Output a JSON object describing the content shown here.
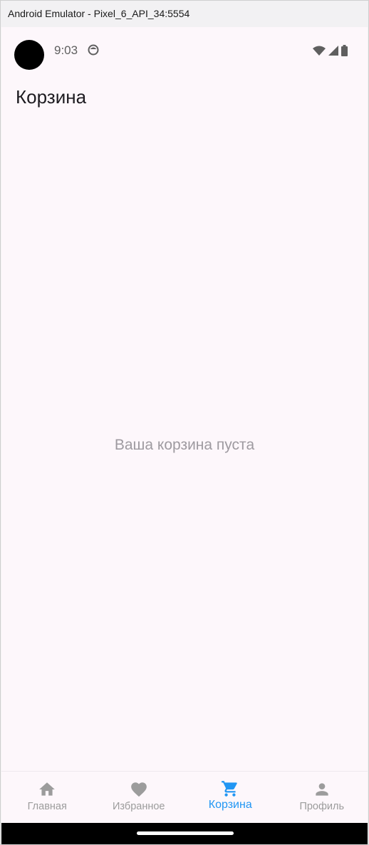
{
  "window": {
    "title": "Android Emulator - Pixel_6_API_34:5554"
  },
  "status_bar": {
    "time": "9:03",
    "icons": [
      "notification-icon",
      "wifi-icon",
      "signal-icon",
      "battery-icon"
    ]
  },
  "app_bar": {
    "title": "Корзина"
  },
  "content": {
    "empty_message": "Ваша корзина пуста"
  },
  "bottom_nav": {
    "items": [
      {
        "label": "Главная",
        "icon": "home-icon",
        "active": false
      },
      {
        "label": "Избранное",
        "icon": "heart-icon",
        "active": false
      },
      {
        "label": "Корзина",
        "icon": "cart-icon",
        "active": true
      },
      {
        "label": "Профиль",
        "icon": "person-icon",
        "active": false
      }
    ]
  },
  "colors": {
    "background": "#fdf7fb",
    "active": "#2196f3",
    "inactive": "#9c9c9c",
    "empty_text": "#9e9aa0",
    "title_text": "#1d1b20"
  }
}
